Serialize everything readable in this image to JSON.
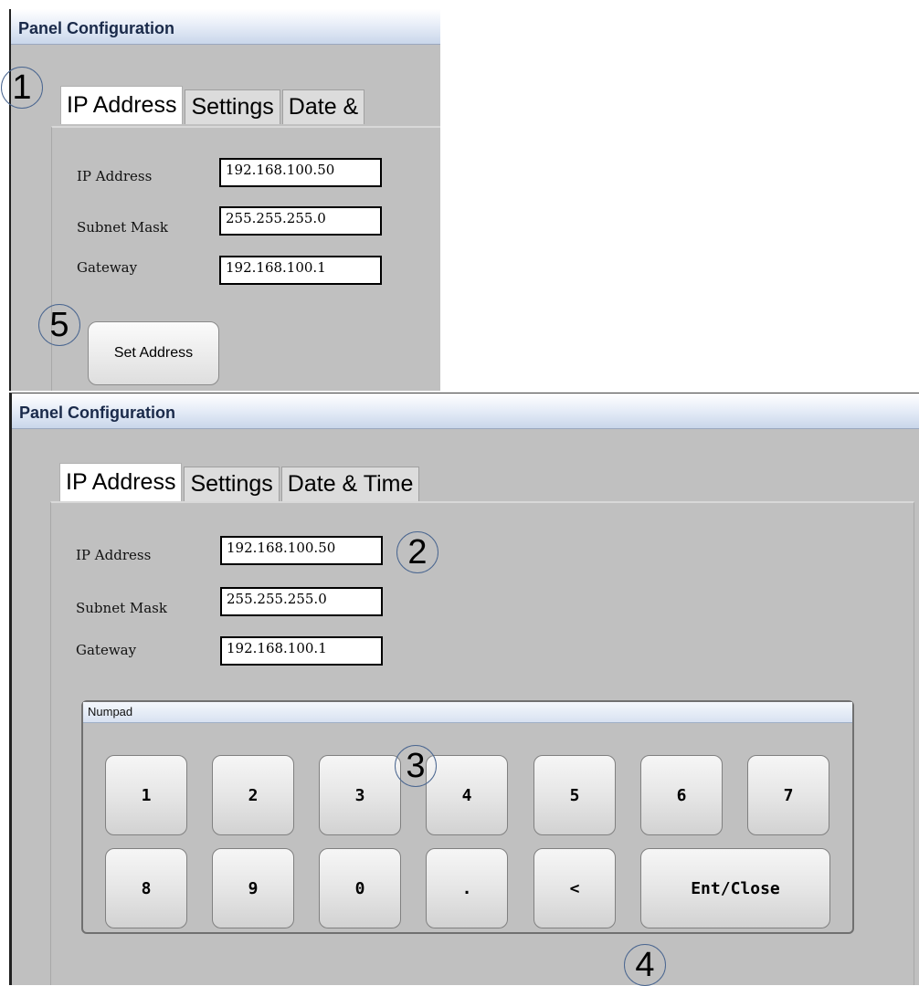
{
  "window_title": "Panel Configuration",
  "tabs": [
    "IP Address",
    "Settings",
    "Date & Time"
  ],
  "tabs_truncated_top": [
    "IP Address",
    "Settings",
    "Date &"
  ],
  "fields_top": {
    "ip_label": "IP Address",
    "ip_value": "192.168.100.50",
    "subnet_label": "Subnet Mask",
    "subnet_value": "255.255.255.0",
    "gateway_label": "Gateway",
    "gateway_value": "192.168.100.1"
  },
  "fields_bottom": {
    "ip_label": "IP Address",
    "ip_value": "192.168.100.50",
    "subnet_label": "Subnet Mask",
    "subnet_value": "255.255.255.0",
    "gateway_label": "Gateway",
    "gateway_value": "192.168.100.1"
  },
  "set_address_label": "Set Address",
  "numpad": {
    "title": "Numpad",
    "row1": [
      "1",
      "2",
      "3",
      "4",
      "5",
      "6",
      "7"
    ],
    "row2": [
      "8",
      "9",
      "0",
      ".",
      "<",
      "Ent/Close"
    ]
  },
  "callouts": [
    "1",
    "2",
    "3",
    "4",
    "5"
  ],
  "colors": {
    "window_bg": "#c0c0c0",
    "title_text": "#1a2a4a",
    "callout_ring": "#4a6690"
  }
}
